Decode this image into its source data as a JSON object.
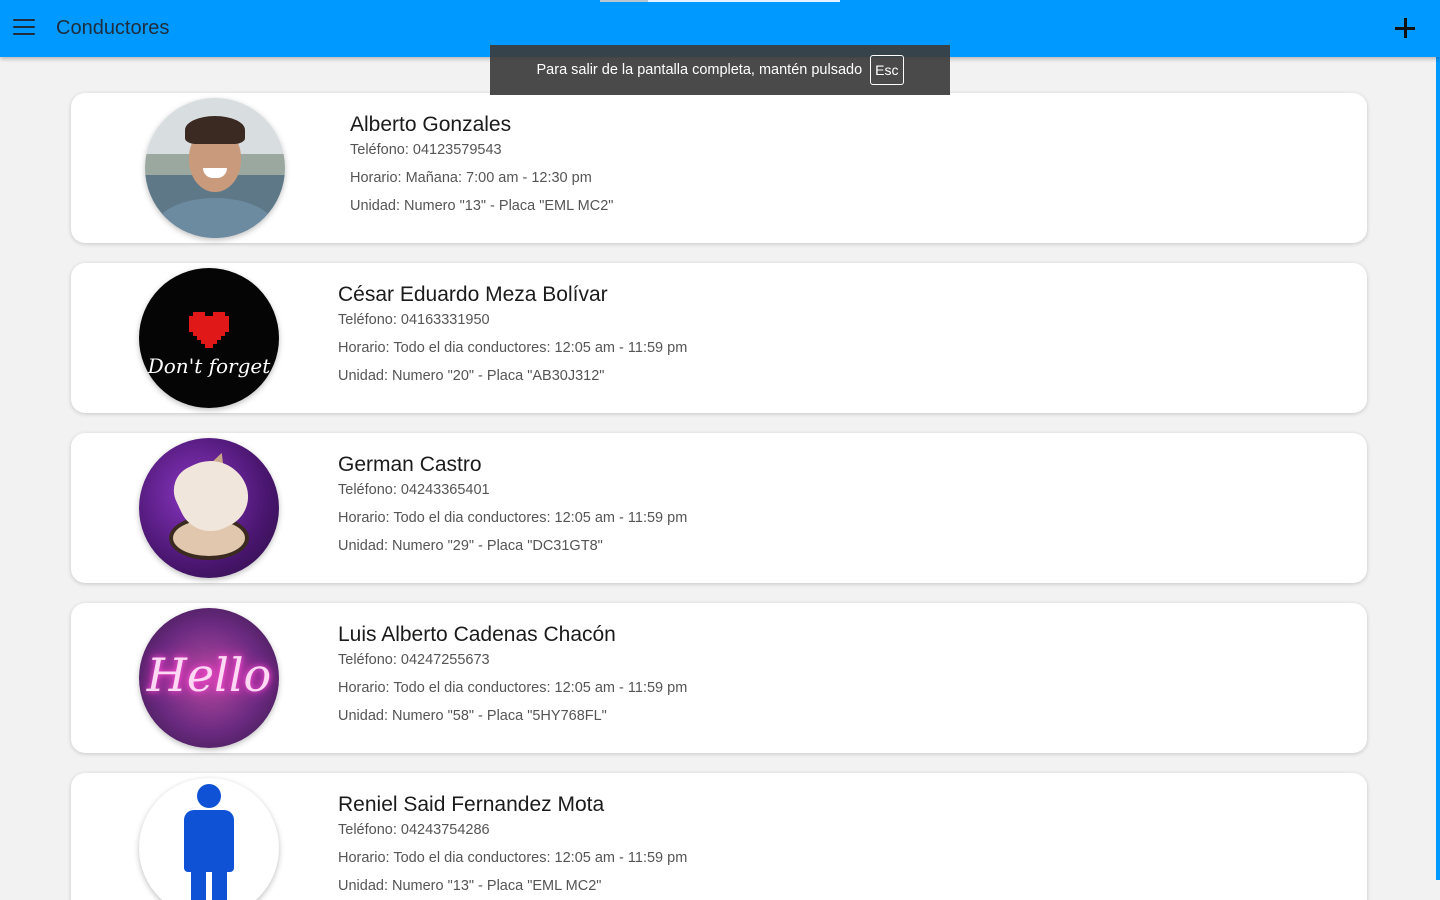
{
  "appbar": {
    "title": "Conductores",
    "accent_color": "#0099ff",
    "menu_icon": "hamburger-menu-icon",
    "add_icon": "plus-icon"
  },
  "toast": {
    "message": "Para salir de la pantalla completa, mantén pulsado",
    "key": "Esc"
  },
  "drivers": [
    {
      "name": "Alberto Gonzales",
      "phone": "Teléfono: 04123579543",
      "schedule": "Horario: Mañana: 7:00 am - 12:30 pm",
      "unit": "Unidad: Numero \"13\" - Placa \"EML MC2\"",
      "avatar": "portrait-photo"
    },
    {
      "name": "César Eduardo Meza Bolívar",
      "phone": "Teléfono: 04163331950",
      "schedule": "Horario: Todo el dia conductores: 12:05 am - 11:59 pm",
      "unit": "Unidad: Numero \"20\" - Placa \"AB30J312\"",
      "avatar": "heart-image",
      "avatar_caption": "Don't forget"
    },
    {
      "name": "German Castro",
      "phone": "Teléfono: 04243365401",
      "schedule": "Horario: Todo el dia conductores: 12:05 am - 11:59 pm",
      "unit": "Unidad: Numero \"29\" - Placa \"DC31GT8\"",
      "avatar": "fox-logo"
    },
    {
      "name": "Luis Alberto Cadenas Chacón",
      "phone": "Teléfono: 04247255673",
      "schedule": "Horario: Todo el dia conductores: 12:05 am - 11:59 pm",
      "unit": "Unidad: Numero \"58\" - Placa \"5HY768FL\"",
      "avatar": "neon-sign",
      "avatar_caption": "Hello"
    },
    {
      "name": "Reniel Said Fernandez Mota",
      "phone": "Teléfono: 04243754286",
      "schedule": "Horario: Todo el dia conductores: 12:05 am - 11:59 pm",
      "unit": "Unidad: Numero \"13\" - Placa \"EML MC2\"",
      "avatar": "person-icon"
    }
  ]
}
